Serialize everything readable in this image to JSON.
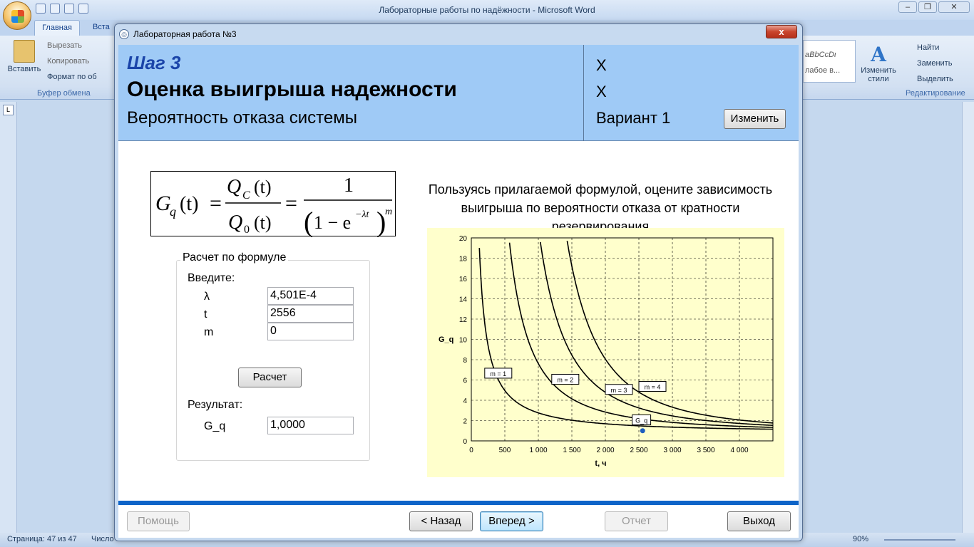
{
  "word": {
    "title": "Лабораторные работы по надёжности - Microsoft Word",
    "tab_home": "Главная",
    "tab_insert": "Вста",
    "paste_label": "Вставить",
    "cut_label": "Вырезать",
    "copy_label": "Копировать",
    "format_label": "Формат по об",
    "clipboard_group": "Буфер обмена",
    "styles_preview": "aBbCcDι",
    "styles_caption": "лабое в...",
    "change_styles": "Изменить стили",
    "find_label": "Найти",
    "replace_label": "Заменить",
    "select_label": "Выделить",
    "editing_group": "Редактирование",
    "ruler_corner": "L",
    "status_page": "Страница: 47 из 47",
    "status_words": "Число",
    "zoom": "90%"
  },
  "dialog": {
    "title": "Лабораторная работа №3",
    "close_label": "x",
    "step": "Шаг 3",
    "main_title": "Оценка выигрыша надежности",
    "sub_title": "Вероятность отказа системы",
    "x1": "X",
    "x2": "X",
    "variant": "Вариант 1",
    "change_button": "Изменить",
    "instruction": "Пользуясь прилагаемой формулой, оцените зависимость выигрыша по вероятности отказа от кратности резервирования",
    "calc_group": "Расчет по формуле",
    "enter_label": "Введите:",
    "lambda_label": "λ",
    "lambda_value": "4,501E-4",
    "t_label": "t",
    "t_value": "2556",
    "m_label": "m",
    "m_value": "0",
    "calc_button": "Расчет",
    "result_label": "Результат:",
    "gq_label": "G_q",
    "gq_value": "1,0000",
    "help_button": "Помощь",
    "back_button": "< Назад",
    "next_button": "Вперед >",
    "report_button": "Отчет",
    "exit_button": "Выход"
  },
  "formula": {
    "lhs": "G",
    "lhs_sub": "q",
    "arg": "(t)",
    "num": "Q",
    "num_sub": "C",
    "den": "Q",
    "den_sub": "0",
    "one": "1",
    "den2_a": "1 − e",
    "exp": "−λt",
    "power": "m"
  },
  "chart_data": {
    "type": "line",
    "xlabel": "t, ч",
    "ylabel": "G_q",
    "xlim": [
      0,
      4500
    ],
    "ylim": [
      0,
      20
    ],
    "x_ticks": [
      0,
      500,
      1000,
      1500,
      2000,
      2500,
      3000,
      3500,
      4000
    ],
    "x_tick_labels": [
      "0",
      "500",
      "1 000",
      "1 500",
      "2 000",
      "2 500",
      "3 000",
      "3 500",
      "4 000"
    ],
    "y_ticks": [
      0,
      2,
      4,
      6,
      8,
      10,
      12,
      14,
      16,
      18,
      20
    ],
    "grid": true,
    "lambda": 0.0004501,
    "series": [
      {
        "name": "m = 1",
        "m": 1,
        "label_x": 200,
        "label_y": 6.6
      },
      {
        "name": "m = 2",
        "m": 2,
        "label_x": 1200,
        "label_y": 6.0
      },
      {
        "name": "m = 3",
        "m": 3,
        "label_x": 2000,
        "label_y": 5.0
      },
      {
        "name": "m = 4",
        "m": 4,
        "label_x": 2500,
        "label_y": 5.3
      }
    ],
    "marker_series": {
      "name": "G_q",
      "x": 2556,
      "y": 1.0,
      "label_x": 2400,
      "label_y": 2.0
    },
    "colors": {
      "curve": "#000000",
      "marker": "#1f5fbf",
      "background": "#ffffcc",
      "grid": "#000000"
    }
  }
}
